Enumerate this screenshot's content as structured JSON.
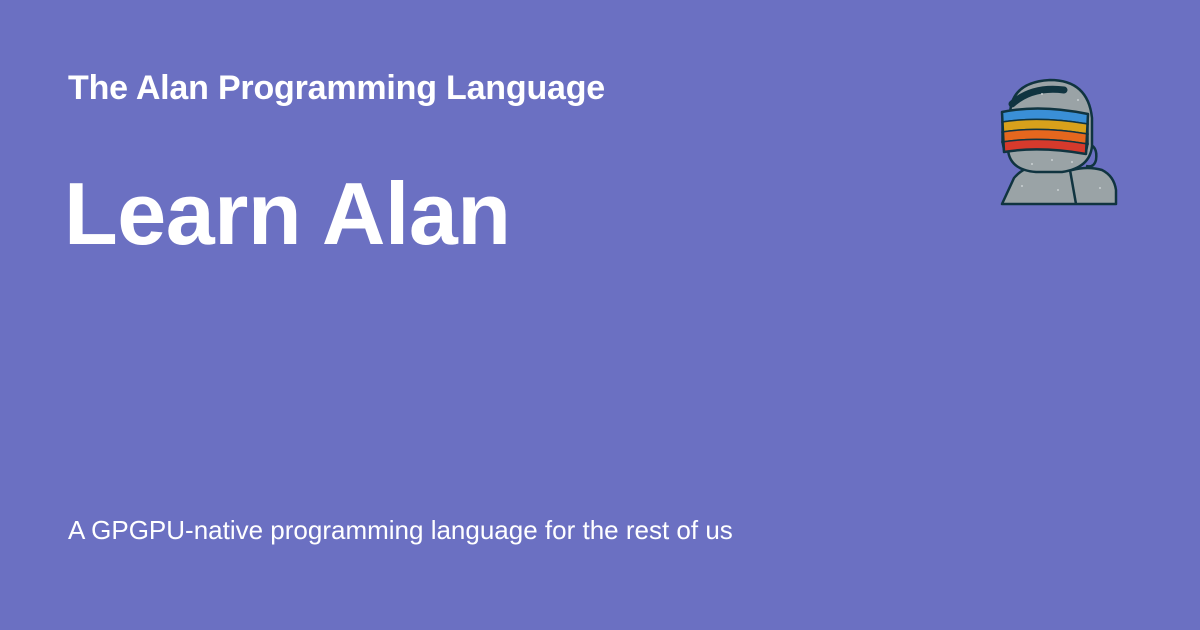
{
  "site": {
    "title": "The Alan Programming Language"
  },
  "page": {
    "title": "Learn Alan",
    "description": "A GPGPU-native programming language for the rest of us"
  },
  "logo": {
    "icon": "astronaut-helmet-rainbow-visor-icon"
  },
  "colors": {
    "background": "#6b70c2",
    "text": "#ffffff",
    "helmet": "#9aa3a6",
    "outline": "#103440",
    "visor_blue": "#3a8fd6",
    "visor_gold": "#d8a11b",
    "visor_orange": "#e5671e",
    "visor_red": "#d63a2c"
  }
}
